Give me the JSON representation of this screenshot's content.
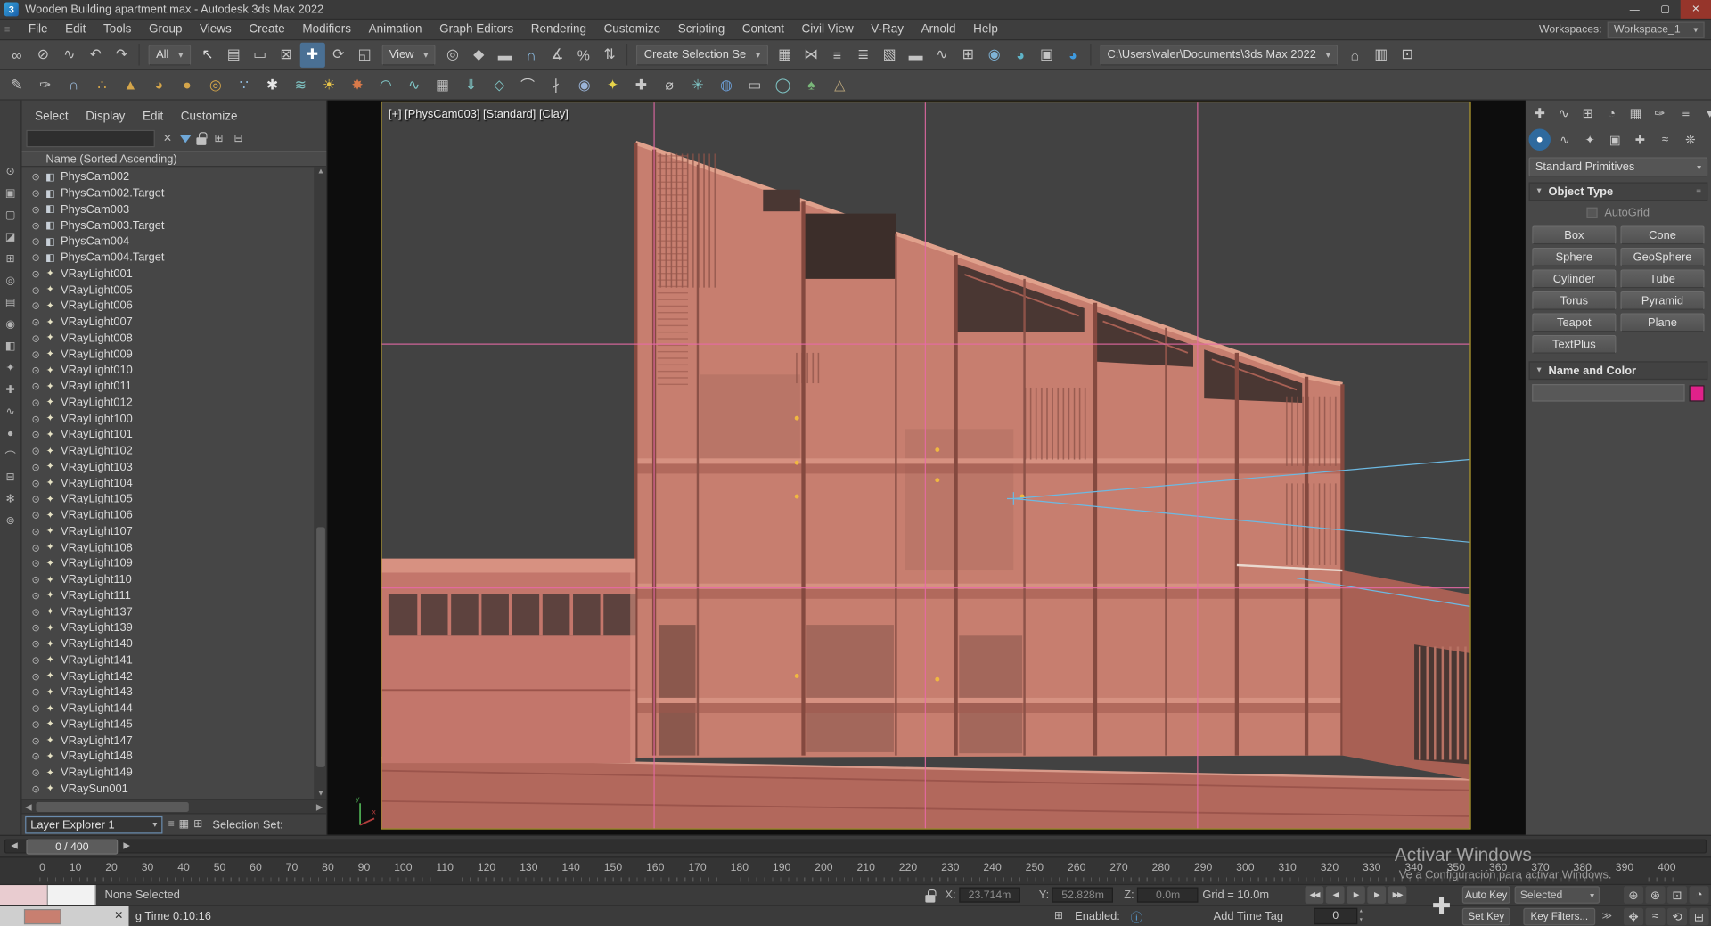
{
  "colors": {
    "accent": "#4a7094",
    "frame-yellow": "#b29a2a",
    "building": "#c77e6f",
    "grid-pink": "#e86aa8",
    "cam-blue": "#6cb9e2",
    "swatch-pink": "#e0218a",
    "light-dot": "#f0b840"
  },
  "ui": {
    "dd": "▾",
    "left": "◀",
    "right": "▶",
    "up": "▲",
    "down": "▼",
    "close": "✕",
    "spin_up": "▴",
    "spin_dn": "▾",
    "gt": "≫"
  },
  "window": {
    "app_icon": "3",
    "title": "Wooden Building apartment.max - Autodesk 3ds Max 2022",
    "controls": [
      {
        "n": "minimize-button",
        "g": "—"
      },
      {
        "n": "maximize-button",
        "g": "▢"
      },
      {
        "n": "close-button",
        "g": "✕"
      }
    ],
    "workspaces_label": "Workspaces:",
    "workspace_value": "Workspace_1"
  },
  "menu": [
    "File",
    "Edit",
    "Tools",
    "Group",
    "Views",
    "Create",
    "Modifiers",
    "Animation",
    "Graph Editors",
    "Rendering",
    "Customize",
    "Scripting",
    "Content",
    "Civil View",
    "V-Ray",
    "Arnold",
    "Help"
  ],
  "toolbar1": {
    "groupA": [
      {
        "n": "select-and-link-icon",
        "g": "∞",
        "c": "#c4c4c4"
      },
      {
        "n": "unlink-selection-icon",
        "g": "⊘",
        "c": "#c4c4c4"
      },
      {
        "n": "bind-to-space-warp-icon",
        "g": "∿",
        "c": "#c4c4c4"
      },
      {
        "n": "undo-icon",
        "g": "↶",
        "c": "#c4c4c4"
      },
      {
        "n": "redo-icon",
        "g": "↷",
        "c": "#c4c4c4"
      }
    ],
    "filter_dropdown": "All",
    "groupB": [
      {
        "n": "select-object-icon",
        "g": "↖",
        "c": "#dcdcdc"
      },
      {
        "n": "select-by-name-icon",
        "g": "▤",
        "c": "#c4c4c4"
      },
      {
        "n": "rectangular-selection-region-icon",
        "g": "▭",
        "c": "#c4c4c4"
      },
      {
        "n": "window-crossing-icon",
        "g": "⊠",
        "c": "#c4c4c4"
      },
      {
        "n": "select-and-move-icon",
        "g": "✚",
        "c": "#ffffff",
        "bg": "#4a7094"
      },
      {
        "n": "select-and-rotate-icon",
        "g": "⟳",
        "c": "#c4c4c4"
      },
      {
        "n": "select-and-scale-icon",
        "g": "◱",
        "c": "#c4c4c4"
      }
    ],
    "coord_dropdown": "View",
    "groupC": [
      {
        "n": "use-pivot-point-icon",
        "g": "◎",
        "c": "#c4c4c4"
      },
      {
        "n": "select-and-manipulate-icon",
        "g": "◆",
        "c": "#c4c4c4"
      },
      {
        "n": "keyboard-shortcut-override-icon",
        "g": "▬",
        "c": "#c4c4c4"
      },
      {
        "n": "snaps-toggle-icon",
        "g": "∩",
        "c": "#8fc0e8"
      },
      {
        "n": "angle-snap-icon",
        "g": "∡",
        "c": "#c4c4c4"
      },
      {
        "n": "percent-snap-icon",
        "g": "%",
        "c": "#c4c4c4"
      },
      {
        "n": "spinner-snap-icon",
        "g": "⇅",
        "c": "#c4c4c4"
      }
    ],
    "selection_set_dropdown": "Create Selection Se",
    "groupD": [
      {
        "n": "edit-named-selection-sets-icon",
        "g": "▦",
        "c": "#c4c4c4"
      },
      {
        "n": "mirror-icon",
        "g": "⋈",
        "c": "#c4c4c4"
      },
      {
        "n": "align-icon",
        "g": "≡",
        "c": "#c4c4c4"
      },
      {
        "n": "toggle-scene-explorer-icon",
        "g": "≣",
        "c": "#c4c4c4"
      },
      {
        "n": "toggle-layer-explorer-icon",
        "g": "▧",
        "c": "#c4c4c4"
      },
      {
        "n": "toggle-ribbon-icon",
        "g": "▬",
        "c": "#c4c4c4"
      },
      {
        "n": "curve-editor-icon",
        "g": "∿",
        "c": "#c4c4c4"
      },
      {
        "n": "schematic-view-icon",
        "g": "⊞",
        "c": "#c4c4c4"
      },
      {
        "n": "material-editor-icon",
        "g": "◉",
        "c": "#7fb4d8"
      },
      {
        "n": "render-setup-icon",
        "g": "◕",
        "c": "#5fb4c8"
      },
      {
        "n": "rendered-frame-window-icon",
        "g": "▣",
        "c": "#c4c4c4"
      },
      {
        "n": "render-production-icon",
        "g": "◕",
        "c": "#3f9ade"
      }
    ],
    "path_dropdown": "C:\\Users\\valer\\Documents\\3ds Max 2022",
    "groupE": [
      {
        "n": "project-folder-icon",
        "g": "⌂",
        "c": "#c4c4c4"
      },
      {
        "n": "asset-library-icon",
        "g": "▥",
        "c": "#c4c4c4"
      },
      {
        "n": "open-recent-icon",
        "g": "⊡",
        "c": "#c4c4c4"
      }
    ]
  },
  "toolbar2": {
    "icons": [
      {
        "n": "pencil-icon",
        "g": "✎",
        "c": "#c8c8c8"
      },
      {
        "n": "paint-deform-icon",
        "g": "✑",
        "c": "#c8c8c8"
      },
      {
        "n": "magnet-snap-icon",
        "g": "∩",
        "c": "#9ab8d8"
      },
      {
        "n": "scatter-icon",
        "g": "∴",
        "c": "#d4a54a"
      },
      {
        "n": "cone-primitive-icon",
        "g": "▲",
        "c": "#d4a54a"
      },
      {
        "n": "teapot-primitive-icon",
        "g": "◕",
        "c": "#d4a54a"
      },
      {
        "n": "sphere-primitive-icon",
        "g": "●",
        "c": "#d4a54a"
      },
      {
        "n": "torus-primitive-icon",
        "g": "◎",
        "c": "#d4a54a"
      },
      {
        "n": "spray-particles-icon",
        "g": "∵",
        "c": "#8fb8d8"
      },
      {
        "n": "snow-particles-icon",
        "g": "✱",
        "c": "#e8e8e8"
      },
      {
        "n": "wind-force-icon",
        "g": "≋",
        "c": "#7fc4c4"
      },
      {
        "n": "sun-daylight-icon",
        "g": "☀",
        "c": "#e8c44a"
      },
      {
        "n": "bomb-force-icon",
        "g": "✸",
        "c": "#d87a4a"
      },
      {
        "n": "ripple-modifier-icon",
        "g": "◠",
        "c": "#7fc4c4"
      },
      {
        "n": "wave-modifier-icon",
        "g": "∿",
        "c": "#7fc4c4"
      },
      {
        "n": "displace-modifier-icon",
        "g": "▦",
        "c": "#b8b8b8"
      },
      {
        "n": "gravity-force-icon",
        "g": "⇓",
        "c": "#7fc4c4"
      },
      {
        "n": "deflector-icon",
        "g": "◇",
        "c": "#7fc4c4"
      },
      {
        "n": "bones-icon",
        "g": "⌒",
        "c": "#c8c8c8"
      },
      {
        "n": "biped-icon",
        "g": "∤",
        "c": "#c8c8c8"
      },
      {
        "n": "camera-create-icon",
        "g": "◉",
        "c": "#9ab4d8"
      },
      {
        "n": "light-create-icon",
        "g": "✦",
        "c": "#e8d44a"
      },
      {
        "n": "helper-create-icon",
        "g": "✚",
        "c": "#c8c8c8"
      },
      {
        "n": "tape-measure-icon",
        "g": "⌀",
        "c": "#c8c8c8"
      },
      {
        "n": "compass-icon",
        "g": "✳",
        "c": "#7fc4c4"
      },
      {
        "n": "material-sphere-icon",
        "g": "◍",
        "c": "#6a9ad0"
      },
      {
        "n": "monitor-icon",
        "g": "▭",
        "c": "#c8c8c8"
      },
      {
        "n": "globe-icon",
        "g": "◯",
        "c": "#7fc4c4"
      },
      {
        "n": "foliage-icon",
        "g": "♠",
        "c": "#7ab87a"
      },
      {
        "n": "terrain-icon",
        "g": "△",
        "c": "#b8a47a"
      }
    ]
  },
  "explorer": {
    "side_icons": [
      {
        "n": "find-icon",
        "g": "⊙"
      },
      {
        "n": "select-all-icon",
        "g": "▣"
      },
      {
        "n": "select-none-icon",
        "g": "▢"
      },
      {
        "n": "select-invert-icon",
        "g": "◪"
      },
      {
        "n": "select-children-icon",
        "g": "⊞"
      },
      {
        "n": "display-objects-icon",
        "g": "◎"
      },
      {
        "n": "display-layers-icon",
        "g": "▤"
      },
      {
        "n": "display-materials-icon",
        "g": "◉"
      },
      {
        "n": "display-cameras-icon",
        "g": "◧"
      },
      {
        "n": "display-lights-icon",
        "g": "✦"
      },
      {
        "n": "display-helpers-icon",
        "g": "✚"
      },
      {
        "n": "display-shapes-icon",
        "g": "∿"
      },
      {
        "n": "display-geometry-icon",
        "g": "●"
      },
      {
        "n": "display-bones-icon",
        "g": "⌒"
      },
      {
        "n": "display-containers-icon",
        "g": "⊟"
      },
      {
        "n": "display-frozen-icon",
        "g": "✻"
      },
      {
        "n": "pin-explorer-icon",
        "g": "⊚"
      }
    ],
    "menu": [
      "Select",
      "Display",
      "Edit",
      "Customize"
    ],
    "header": "Name (Sorted Ascending)",
    "items": [
      {
        "name": "PhysCam002",
        "cls": "cam"
      },
      {
        "name": "PhysCam002.Target",
        "cls": "cam"
      },
      {
        "name": "PhysCam003",
        "cls": "cam"
      },
      {
        "name": "PhysCam003.Target",
        "cls": "cam"
      },
      {
        "name": "PhysCam004",
        "cls": "cam"
      },
      {
        "name": "PhysCam004.Target",
        "cls": "cam"
      },
      {
        "name": "VRayLight001",
        "cls": "light"
      },
      {
        "name": "VRayLight005",
        "cls": "light"
      },
      {
        "name": "VRayLight006",
        "cls": "light"
      },
      {
        "name": "VRayLight007",
        "cls": "light"
      },
      {
        "name": "VRayLight008",
        "cls": "light"
      },
      {
        "name": "VRayLight009",
        "cls": "light"
      },
      {
        "name": "VRayLight010",
        "cls": "light"
      },
      {
        "name": "VRayLight011",
        "cls": "light"
      },
      {
        "name": "VRayLight012",
        "cls": "light"
      },
      {
        "name": "VRayLight100",
        "cls": "light"
      },
      {
        "name": "VRayLight101",
        "cls": "light"
      },
      {
        "name": "VRayLight102",
        "cls": "light"
      },
      {
        "name": "VRayLight103",
        "cls": "light"
      },
      {
        "name": "VRayLight104",
        "cls": "light"
      },
      {
        "name": "VRayLight105",
        "cls": "light"
      },
      {
        "name": "VRayLight106",
        "cls": "light"
      },
      {
        "name": "VRayLight107",
        "cls": "light"
      },
      {
        "name": "VRayLight108",
        "cls": "light"
      },
      {
        "name": "VRayLight109",
        "cls": "light"
      },
      {
        "name": "VRayLight110",
        "cls": "light"
      },
      {
        "name": "VRayLight111",
        "cls": "light"
      },
      {
        "name": "VRayLight137",
        "cls": "light"
      },
      {
        "name": "VRayLight139",
        "cls": "light"
      },
      {
        "name": "VRayLight140",
        "cls": "light"
      },
      {
        "name": "VRayLight141",
        "cls": "light"
      },
      {
        "name": "VRayLight142",
        "cls": "light"
      },
      {
        "name": "VRayLight143",
        "cls": "light"
      },
      {
        "name": "VRayLight144",
        "cls": "light"
      },
      {
        "name": "VRayLight145",
        "cls": "light"
      },
      {
        "name": "VRayLight147",
        "cls": "light"
      },
      {
        "name": "VRayLight148",
        "cls": "light"
      },
      {
        "name": "VRayLight149",
        "cls": "light"
      },
      {
        "name": "VRaySun001",
        "cls": "light"
      }
    ],
    "footer_combo": "Layer Explorer 1",
    "footer_icons": [
      {
        "n": "dock-explorer-icon",
        "g": "≡"
      },
      {
        "n": "grid-view-icon",
        "g": "▦"
      },
      {
        "n": "new-set-icon",
        "g": "⊞"
      }
    ],
    "selection_set_label": "Selection Set:"
  },
  "viewport": {
    "label": "[+] [PhysCam003] [Standard] [Clay]"
  },
  "command_panel": {
    "tabs": [
      {
        "n": "create-tab",
        "g": "✚"
      },
      {
        "n": "modify-tab",
        "g": "∿"
      },
      {
        "n": "hierarchy-tab",
        "g": "⊞"
      },
      {
        "n": "motion-tab",
        "g": "◔"
      },
      {
        "n": "display-tab",
        "g": "▦"
      },
      {
        "n": "utilities-tab",
        "g": "✑"
      }
    ],
    "tab_extras": [
      {
        "n": "pin-stack-icon",
        "g": "≡"
      },
      {
        "n": "panel-menu-icon",
        "g": "▾"
      }
    ],
    "categories": [
      {
        "n": "geometry-category",
        "g": "●",
        "cls": "on"
      },
      {
        "n": "shapes-category",
        "g": "∿"
      },
      {
        "n": "lights-category",
        "g": "✦"
      },
      {
        "n": "cameras-category",
        "g": "▣"
      },
      {
        "n": "helpers-category",
        "g": "✚"
      },
      {
        "n": "spacewarps-category",
        "g": "≈"
      },
      {
        "n": "systems-category",
        "g": "❊"
      }
    ],
    "primitive_dropdown": "Standard Primitives",
    "object_type_title": "Object Type",
    "autogrid_label": "AutoGrid",
    "buttons": [
      "Box",
      "Cone",
      "Sphere",
      "GeoSphere",
      "Cylinder",
      "Tube",
      "Torus",
      "Pyramid",
      "Teapot",
      "Plane",
      "TextPlus"
    ],
    "name_color_title": "Name and Color"
  },
  "timeline": {
    "handle": "0 / 400",
    "ticks": [
      0,
      10,
      20,
      30,
      40,
      50,
      60,
      70,
      80,
      90,
      100,
      110,
      120,
      130,
      140,
      150,
      160,
      170,
      180,
      190,
      200,
      210,
      220,
      230,
      240,
      250,
      260,
      270,
      280,
      290,
      300,
      310,
      320,
      330,
      340,
      350,
      360,
      370,
      380,
      390,
      400
    ]
  },
  "status": {
    "prompt": "None Selected",
    "x_label": "X:",
    "x_value": "23.714m",
    "y_label": "Y:",
    "y_value": "52.828m",
    "z_label": "Z:",
    "z_value": "0.0m",
    "grid_label": "Grid = 10.0m",
    "playback": [
      {
        "n": "go-to-start-button",
        "g": "◀◀"
      },
      {
        "n": "previous-frame-button",
        "g": "◀"
      },
      {
        "n": "play-animation-button",
        "g": "▶"
      },
      {
        "n": "next-frame-button",
        "g": "▶"
      },
      {
        "n": "go-to-end-button",
        "g": "▶▶"
      }
    ],
    "nav_cross": "✚",
    "auto_key": "Auto Key",
    "key_mode_dropdown": "Selected",
    "set_key": "Set Key",
    "key_filters": "Key Filters...",
    "add_time_tag": "Add Time Tag",
    "enabled_label": "Enabled:",
    "info_icon": "ⓘ",
    "frame_value": "0",
    "render_time": "g Time 0:10:16",
    "navs1": [
      {
        "n": "zoom-icon",
        "g": "⊕"
      },
      {
        "n": "zoom-all-icon",
        "g": "⊛"
      },
      {
        "n": "zoom-extents-icon",
        "g": "⊡"
      },
      {
        "n": "field-of-view-icon",
        "g": "◔"
      }
    ],
    "navs2": [
      {
        "n": "pan-icon",
        "g": "✥"
      },
      {
        "n": "walk-through-icon",
        "g": "≈"
      },
      {
        "n": "orbit-icon",
        "g": "⟲"
      },
      {
        "n": "maximize-viewport-toggle-icon",
        "g": "⊞"
      }
    ],
    "watermark_line1": "Activar Windows",
    "watermark_line2": "Ve a Configuración para activar Windows."
  }
}
